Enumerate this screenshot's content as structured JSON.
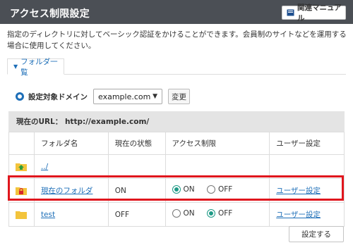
{
  "header": {
    "title": "アクセス制限設定",
    "manual_label": "関連マニュアル"
  },
  "description": "指定のディレクトリに対してベーシック認証をかけることができます。会員制のサイトなどを運用する場合に使用してください。",
  "tab": {
    "label": "フォルダ一覧"
  },
  "domain": {
    "label": "設定対象ドメイン",
    "selected": "example.com",
    "change_label": "変更"
  },
  "current_url": "現在のURL： http://example.com/",
  "table": {
    "headers": [
      "",
      "フォルダ名",
      "現在の状態",
      "アクセス制限",
      "ユーザー設定"
    ],
    "rows": [
      {
        "icon": "folder-up-icon",
        "name": "../",
        "status": "",
        "access": null,
        "user_setting": ""
      },
      {
        "icon": "folder-locked-icon",
        "name": "現在のフォルダ",
        "status": "ON",
        "access": "ON",
        "user_setting": "ユーザー設定"
      },
      {
        "icon": "folder-icon",
        "name": "test",
        "status": "OFF",
        "access": "OFF",
        "user_setting": "ユーザー設定"
      }
    ],
    "on_label": "ON",
    "off_label": "OFF"
  },
  "submit_label": "設定する",
  "colors": {
    "header_bg": "#4b4f55",
    "link": "#1e6fb8",
    "radio_selected": "#1e9a86",
    "highlight": "#e0161d",
    "url_bar_bg": "#e4e4e4"
  }
}
